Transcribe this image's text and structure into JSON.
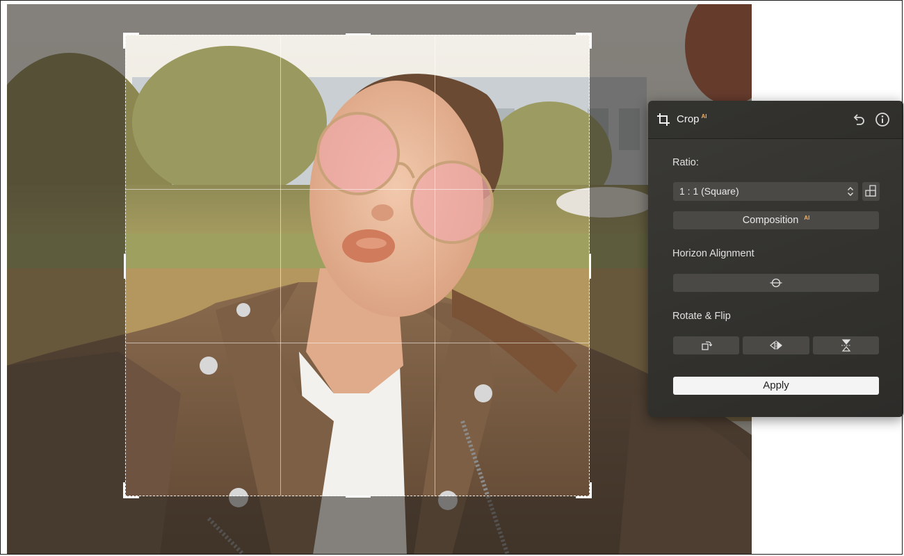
{
  "panel": {
    "title": "Crop",
    "title_badge": "AI",
    "ratio_label": "Ratio:",
    "ratio_value": "1 : 1 (Square)",
    "composition_label": "Composition",
    "composition_badge": "AI",
    "horizon_label": "Horizon Alignment",
    "rotate_flip_label": "Rotate & Flip",
    "apply_label": "Apply"
  },
  "colors": {
    "panel_bg": "#34332f",
    "button_bg": "#4a4945",
    "apply_bg": "#f4f4f4",
    "ai_badge": "#f0b16a"
  },
  "icons": {
    "crop": "crop-icon",
    "undo": "undo-icon",
    "info": "info-icon",
    "orientation": "orientation-toggle-icon",
    "horizon": "horizon-level-icon",
    "rotate": "rotate-icon",
    "flip_horizontal": "flip-horizontal-icon",
    "flip_vertical": "flip-vertical-icon"
  }
}
